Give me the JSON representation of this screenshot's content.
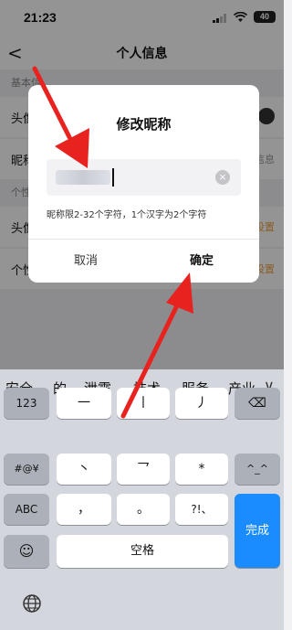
{
  "status_bar": {
    "time": "21:23",
    "battery": "40"
  },
  "header": {
    "back": "<",
    "title": "个人信息"
  },
  "background": {
    "section_basic": "基本信",
    "rows": [
      {
        "label": "头像",
        "value": ""
      },
      {
        "label": "昵称",
        "value": "信息"
      }
    ],
    "section_personal": "个性",
    "rows2": [
      {
        "label": "头像",
        "value": "设置"
      },
      {
        "label": "个性",
        "value": "设置"
      }
    ]
  },
  "dialog": {
    "title": "修改昵称",
    "hint": "昵称限2-32个字符，1个汉字为2个字符",
    "cancel": "取消",
    "confirm": "确定",
    "clear_icon": "×"
  },
  "keyboard": {
    "candidates": [
      "安全",
      "的",
      "泄露",
      "技术",
      "服务",
      "产业"
    ],
    "more": "∨",
    "keys": {
      "num": "123",
      "sym": "#@¥",
      "abc": "ABC",
      "emoji": "☺",
      "stroke1": "一",
      "stroke2": "丨",
      "stroke3": "丿",
      "stroke4": "丶",
      "stroke5": "乛",
      "star": "*",
      "comma": "，",
      "period": "。",
      "punct": "?!、",
      "delete": "⌫",
      "newline": "^_^",
      "space": "空格",
      "done": "完成"
    }
  },
  "colors": {
    "accent": "#1a8cff",
    "arrow": "#e8231f",
    "orange": "#f0a040"
  }
}
